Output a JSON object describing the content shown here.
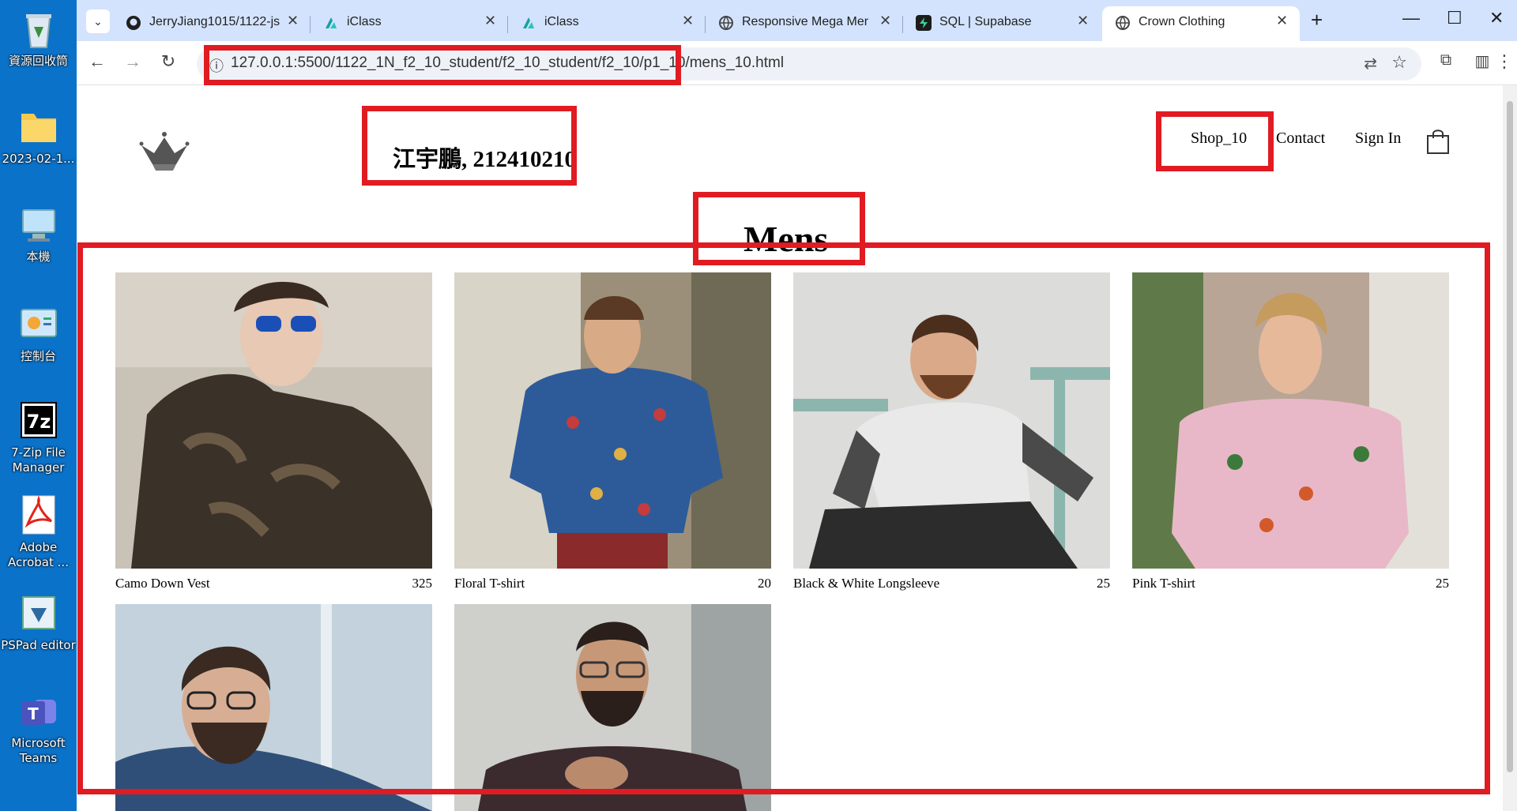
{
  "desktop": {
    "icons": [
      {
        "label": "資源回收筒",
        "icon": "recycle-bin-icon"
      },
      {
        "label": "2023-02-1...",
        "icon": "folder-icon"
      },
      {
        "label": "本機",
        "icon": "computer-icon"
      },
      {
        "label": "控制台",
        "icon": "control-panel-icon"
      },
      {
        "label": "7-Zip File",
        "label2": "Manager",
        "icon": "7zip-icon"
      },
      {
        "label": "Adobe",
        "label2": "Acrobat ...",
        "icon": "acrobat-icon"
      },
      {
        "label": "PSPad editor",
        "icon": "pspad-icon"
      },
      {
        "label": "Microsoft",
        "label2": "Teams",
        "icon": "teams-icon"
      }
    ]
  },
  "browser": {
    "tabs": [
      {
        "title": "JerryJiang1015/1122-js",
        "icon": "github-icon"
      },
      {
        "title": "iClass",
        "icon": "iclass-icon"
      },
      {
        "title": "iClass",
        "icon": "iclass-icon"
      },
      {
        "title": "Responsive Mega Menu",
        "icon": "globe-icon"
      },
      {
        "title": "SQL | Supabase",
        "icon": "supabase-icon"
      },
      {
        "title": "Crown Clothing",
        "icon": "globe-icon"
      }
    ],
    "new_tab": "+",
    "url": "127.0.0.1:5500/1122_1N_f2_10_student/f2_10_student/f2_10/p1_10/mens_10.html"
  },
  "site": {
    "student": "江宇鵬, 212410210",
    "nav": {
      "shop": "Shop_10",
      "contact": "Contact",
      "signin": "Sign In"
    },
    "page_title": "Mens",
    "products": [
      {
        "name": "Camo Down Vest",
        "price": "325"
      },
      {
        "name": "Floral T-shirt",
        "price": "20"
      },
      {
        "name": "Black & White Longsleeve",
        "price": "25"
      },
      {
        "name": "Pink T-shirt",
        "price": "25"
      },
      {
        "name": "",
        "price": ""
      },
      {
        "name": "",
        "price": ""
      }
    ]
  },
  "colors": {
    "highlight": "#e11b22",
    "tabbar": "#d3e3fd",
    "desktop": "#0a72c9"
  }
}
